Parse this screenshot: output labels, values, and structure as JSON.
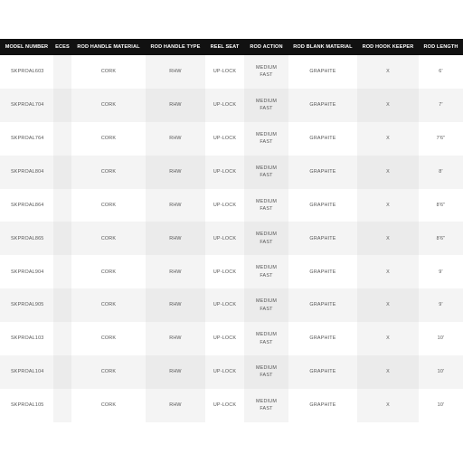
{
  "table": {
    "headers": [
      "MODEL NUMBER",
      "ECES",
      "ROD HANDLE MATERIAL",
      "ROD HANDLE TYPE",
      "REEL SEAT",
      "ROD ACTION",
      "ROD BLANK MATERIAL",
      "ROD HOOK KEEPER",
      "ROD LENGTH"
    ],
    "rows": [
      [
        "SKPROAL603",
        "",
        "CORK",
        "RHW",
        "UP-LOCK",
        [
          "MEDIUM",
          "FAST"
        ],
        "GRAPHITE",
        "X",
        "6'"
      ],
      [
        "SKPROAL704",
        "",
        "CORK",
        "RHW",
        "UP-LOCK",
        [
          "MEDIUM",
          "FAST"
        ],
        "GRAPHITE",
        "X",
        "7'"
      ],
      [
        "SKPROAL764",
        "",
        "CORK",
        "RHW",
        "UP-LOCK",
        [
          "MEDIUM",
          "FAST"
        ],
        "GRAPHITE",
        "X",
        "7'6\""
      ],
      [
        "SKPROAL804",
        "",
        "CORK",
        "RHW",
        "UP-LOCK",
        [
          "MEDIUM",
          "FAST"
        ],
        "GRAPHITE",
        "X",
        "8'"
      ],
      [
        "SKPROAL864",
        "",
        "CORK",
        "RHW",
        "UP-LOCK",
        [
          "MEDIUM",
          "FAST"
        ],
        "GRAPHITE",
        "X",
        "8'6\""
      ],
      [
        "SKPROAL865",
        "",
        "CORK",
        "RHW",
        "UP-LOCK",
        [
          "MEDIUM",
          "FAST"
        ],
        "GRAPHITE",
        "X",
        "8'6\""
      ],
      [
        "SKPROAL904",
        "",
        "CORK",
        "RHW",
        "UP-LOCK",
        [
          "MEDIUM",
          "FAST"
        ],
        "GRAPHITE",
        "X",
        "9'"
      ],
      [
        "SKPROAL905",
        "",
        "CORK",
        "RHW",
        "UP-LOCK",
        [
          "MEDIUM",
          "FAST"
        ],
        "GRAPHITE",
        "X",
        "9'"
      ],
      [
        "SKPROAL103",
        "",
        "CORK",
        "RHW",
        "UP-LOCK",
        [
          "MEDIUM",
          "FAST"
        ],
        "GRAPHITE",
        "X",
        "10'"
      ],
      [
        "SKPROAL104",
        "",
        "CORK",
        "RHW",
        "UP-LOCK",
        [
          "MEDIUM",
          "FAST"
        ],
        "GRAPHITE",
        "X",
        "10'"
      ],
      [
        "SKPROAL105",
        "",
        "CORK",
        "RHW",
        "UP-LOCK",
        [
          "MEDIUM",
          "FAST"
        ],
        "GRAPHITE",
        "X",
        "10'"
      ]
    ]
  },
  "colors": {
    "header_background": "#111111",
    "header_text": "#ffffff",
    "cell_text": "#555555",
    "row_light": "#ffffff",
    "row_shaded": "#f4f4f4"
  }
}
